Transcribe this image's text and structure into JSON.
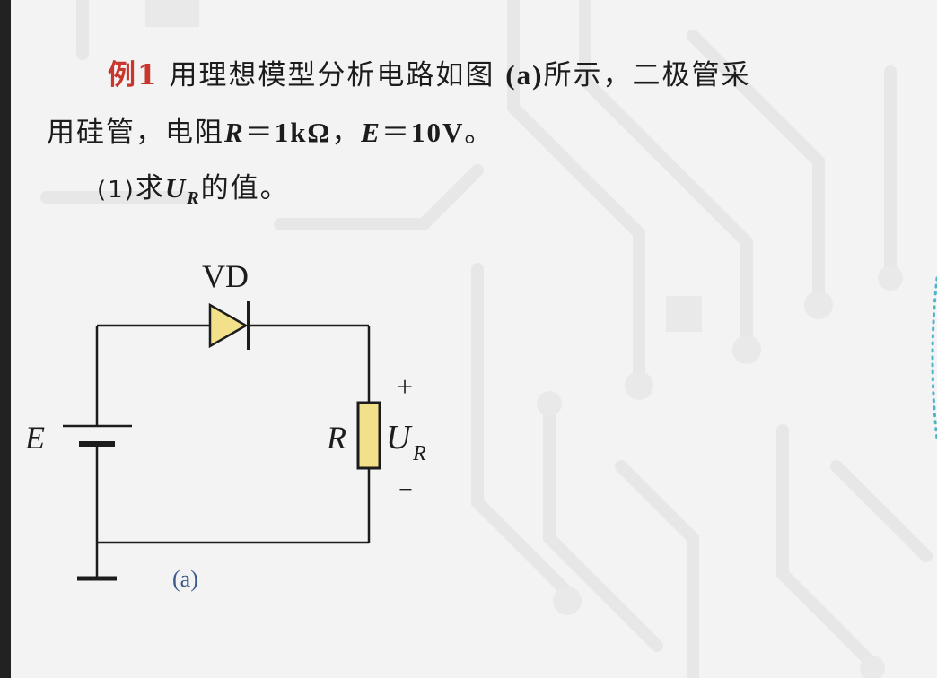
{
  "problem": {
    "example_label": "例1",
    "line1_text": "用理想模型分析电路如图",
    "fig_ref": "(a)",
    "line1_tail": "所示，二极管采",
    "line2_text": "用硅管，电阻",
    "r_sym": "R",
    "r_eq": "＝",
    "r_val": "1kΩ",
    "sep": "，",
    "e_sym": "E",
    "e_eq": "＝",
    "e_val": "10V",
    "end": "。",
    "q1_num": "(1)",
    "q1_pre": "求",
    "ur_sym": "U",
    "ur_sub": "R",
    "q1_post": "的值。"
  },
  "circuit": {
    "diode_label": "VD",
    "source_label": "E",
    "resistor_label": "R",
    "voltage_label": "U",
    "voltage_sub": "R",
    "plus": "+",
    "minus": "−",
    "caption": "(a)",
    "colors": {
      "wire": "#1c1c1c",
      "component_fill": "#f2e08a",
      "caption": "#3a5a8c"
    }
  }
}
